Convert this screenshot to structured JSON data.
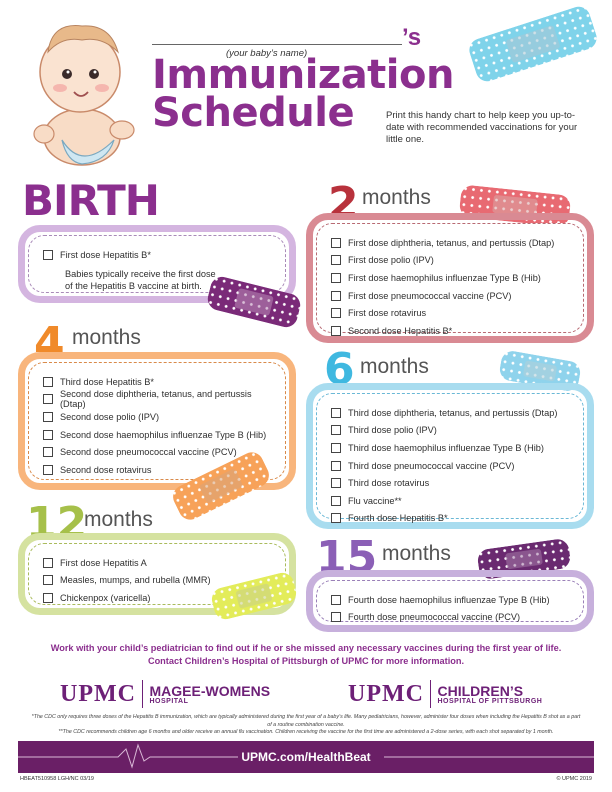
{
  "header": {
    "name_suffix": "’s",
    "name_hint": "(your baby’s name)",
    "title_line1": "Immunization",
    "title_line2": "Schedule",
    "intro": "Print this handy chart to help keep you up-to-date with recommended vaccinations for your little one."
  },
  "sections": {
    "birth": {
      "label": "BIRTH",
      "items": [
        "First dose Hepatitis B*"
      ],
      "note_line1": "Babies typically receive the first dose",
      "note_line2": "of the Hepatitis B vaccine at birth."
    },
    "m2": {
      "number": "2",
      "word": "months",
      "items": [
        "First dose diphtheria, tetanus, and pertussis (Dtap)",
        "First dose polio (IPV)",
        "First dose haemophilus influenzae Type B (Hib)",
        "First dose pneumococcal vaccine (PCV)",
        "First dose rotavirus",
        "Second dose Hepatitis B*"
      ]
    },
    "m4": {
      "number": "4",
      "word": "months",
      "items": [
        "Third dose Hepatitis B*",
        "Second dose diphtheria, tetanus, and pertussis (Dtap)",
        "Second dose polio (IPV)",
        "Second dose haemophilus influenzae Type B (Hib)",
        "Second dose pneumococcal vaccine (PCV)",
        "Second dose rotavirus"
      ]
    },
    "m6": {
      "number": "6",
      "word": "months",
      "items": [
        "Third dose diphtheria, tetanus, and pertussis (Dtap)",
        "Third dose polio (IPV)",
        "Third dose haemophilus influenzae Type B (Hib)",
        "Third dose pneumococcal vaccine (PCV)",
        "Third dose rotavirus",
        "Flu vaccine**",
        "Fourth dose Hepatitis B*"
      ]
    },
    "m12": {
      "number": "12",
      "word": "months",
      "items": [
        "First dose Hepatitis A",
        "Measles, mumps, and rubella (MMR)",
        "Chickenpox (varicella)"
      ]
    },
    "m15": {
      "number": "15",
      "word": "months",
      "items": [
        "Fourth dose haemophilus influenzae Type B (Hib)",
        "Fourth dose pneumococcal vaccine (PCV)"
      ]
    }
  },
  "footer": {
    "message_line1": "Work with your child’s pediatrician to find out if he or she missed any necessary vaccines during the first year of life.",
    "message_line2": "Contact Children’s Hospital of Pittsburgh of UPMC for more information.",
    "logo1_upmc": "UPMC",
    "logo1_big": "MAGEE-WOMENS",
    "logo1_small": "HOSPITAL",
    "logo2_upmc": "UPMC",
    "logo2_big": "CHILDREN’S",
    "logo2_small": "HOSPITAL OF PITTSBURGH",
    "footnote1": "*The CDC only requires three doses of the Hepatitis B immunization, which are typically administered during the first year of a baby’s life. Many pediatricians, however, administer four doses when including the Hepatitis B shot as a part of a routine combination vaccine.",
    "footnote2": "**The CDC recommends children age 6 months and older receive an annual flu vaccination. Children receiving the vaccine for the first time are administered a 2-dose series, with each shot separated by 1 month.",
    "url": "UPMC.com/HealthBeat",
    "code_left": "HBEAT510958 LGH/NC 03/19",
    "code_right": "© UPMC 2019"
  },
  "colors": {
    "title_purple": "#8b2f8e",
    "birth": "#c9a6d8",
    "m2": "#d98a93",
    "m4": "#f6a35c",
    "m6": "#8fd3ec",
    "m12": "#c8d88a",
    "m15": "#b99bd1",
    "footer_bar": "#6a1f66"
  },
  "icons": [
    "baby-illustration",
    "bandaid-icon",
    "heartbeat-line-icon"
  ]
}
